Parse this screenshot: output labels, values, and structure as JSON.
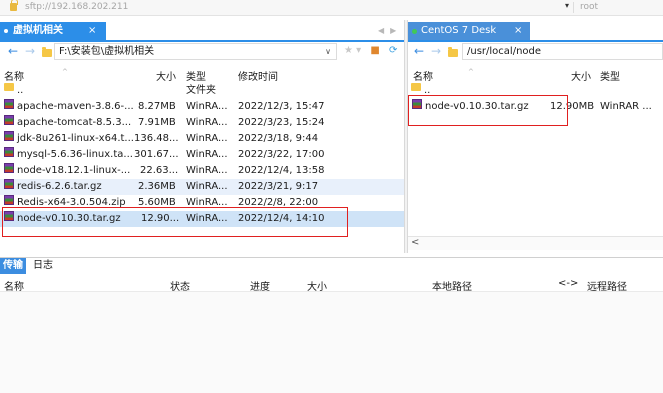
{
  "address": {
    "host": "sftp://192.168.202.211",
    "user": "root"
  },
  "left_tab": {
    "label": "虚拟机相关",
    "close": "×"
  },
  "right_tab": {
    "label": "CentOS 7 Desk",
    "close": "×"
  },
  "left_path": "F:\\安装包\\虚拟机相关",
  "right_path": "/usr/local/node",
  "columns": {
    "name": "名称",
    "size": "大小",
    "type": "类型",
    "modified": "修改时间"
  },
  "left_files": [
    {
      "name": "..",
      "size": "",
      "type": "文件夹",
      "modified": "",
      "icon": "folder-icon"
    },
    {
      "name": "apache-maven-3.8.6-...",
      "size": "8.27MB",
      "type": "WinRA...",
      "modified": "2022/12/3, 15:47",
      "icon": "rar-file-icon"
    },
    {
      "name": "apache-tomcat-8.5.3...",
      "size": "7.91MB",
      "type": "WinRA...",
      "modified": "2022/3/23, 15:24",
      "icon": "rar-file-icon"
    },
    {
      "name": "jdk-8u261-linux-x64.t...",
      "size": "136.48...",
      "type": "WinRA...",
      "modified": "2022/3/18, 9:44",
      "icon": "rar-file-icon"
    },
    {
      "name": "mysql-5.6.36-linux.ta...",
      "size": "301.67...",
      "type": "WinRA...",
      "modified": "2022/3/22, 17:00",
      "icon": "rar-file-icon"
    },
    {
      "name": "node-v18.12.1-linux-...",
      "size": "22.63...",
      "type": "WinRA...",
      "modified": "2022/12/4, 13:58",
      "icon": "rar-file-icon"
    },
    {
      "name": "redis-6.2.6.tar.gz",
      "size": "2.36MB",
      "type": "WinRA...",
      "modified": "2022/3/21, 9:17",
      "icon": "rar-file-icon"
    },
    {
      "name": "Redis-x64-3.0.504.zip",
      "size": "5.60MB",
      "type": "WinRA...",
      "modified": "2022/2/8, 22:00",
      "icon": "rar-file-icon"
    },
    {
      "name": "node-v0.10.30.tar.gz",
      "size": "12.90...",
      "type": "WinRA...",
      "modified": "2022/12/4, 14:10",
      "icon": "rar-file-icon"
    }
  ],
  "right_files": [
    {
      "name": "..",
      "size": "",
      "type": "",
      "icon": "folder-icon"
    },
    {
      "name": "node-v0.10.30.tar.gz",
      "size": "12.90MB",
      "type": "WinRAR ...",
      "icon": "rar-file-icon"
    }
  ],
  "bottom_tabs": {
    "transfer": "传输",
    "log": "日志"
  },
  "transfer_columns": {
    "name": "名称",
    "status": "状态",
    "progress": "进度",
    "size": "大小",
    "local_path": "本地路径",
    "direction": "<->",
    "remote_path": "远程路径"
  },
  "colors": {
    "accent": "#2c8ee8",
    "highlight_box": "#e02020",
    "selected_row": "#cfe3f7"
  }
}
